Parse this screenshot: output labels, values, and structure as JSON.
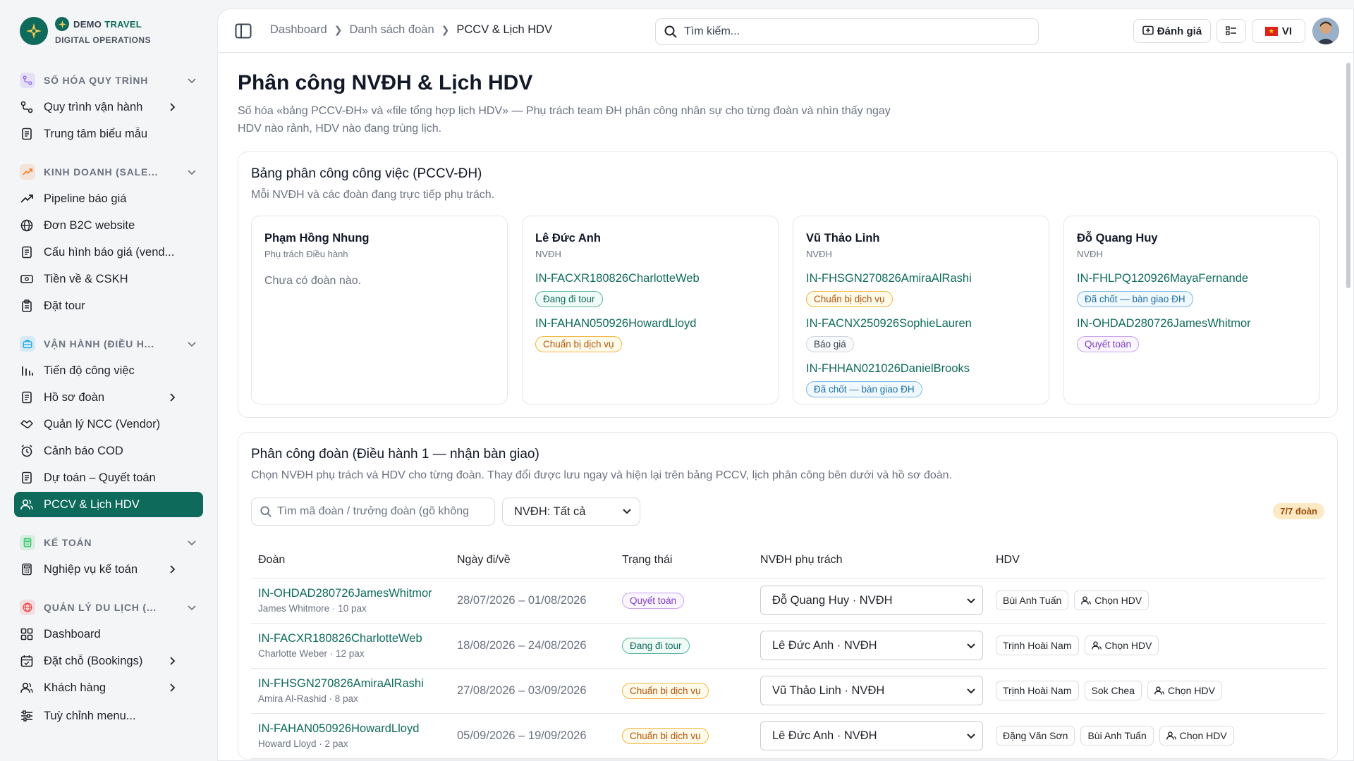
{
  "brand": {
    "name_bold": "DEMO",
    "name_accent": "TRAVEL",
    "subtitle": "DIGITAL OPERATIONS"
  },
  "sidebar": {
    "groups": [
      {
        "label": "SỐ HÓA QUY TRÌNH",
        "icon": "workflow-icon",
        "color": "#8b5cf6",
        "items": [
          {
            "label": "Quy trình vận hành",
            "icon": "workflow-icon",
            "has_children": true
          },
          {
            "label": "Trung tâm biểu mẫu",
            "icon": "document-icon",
            "has_children": false
          }
        ]
      },
      {
        "label": "KINH DOANH (SALE...",
        "icon": "trend-up-icon",
        "color": "#f97316",
        "items": [
          {
            "label": "Pipeline báo giá",
            "icon": "trend-up-icon",
            "has_children": false
          },
          {
            "label": "Đơn B2C website",
            "icon": "globe-icon",
            "has_children": false
          },
          {
            "label": "Cấu hình báo giá (vend...",
            "icon": "document-icon",
            "has_children": false
          },
          {
            "label": "Tiền về & CSKH",
            "icon": "money-icon",
            "has_children": false
          },
          {
            "label": "Đặt tour",
            "icon": "clipboard-icon",
            "has_children": false
          }
        ]
      },
      {
        "label": "VẬN HÀNH (ĐIỀU H...",
        "icon": "briefcase-icon",
        "color": "#0ea5e9",
        "items": [
          {
            "label": "Tiến độ công việc",
            "icon": "progress-icon",
            "has_children": false
          },
          {
            "label": "Hồ sơ đoàn",
            "icon": "document-icon",
            "has_children": true
          },
          {
            "label": "Quản lý NCC (Vendor)",
            "icon": "handshake-icon",
            "has_children": false
          },
          {
            "label": "Cảnh báo COD",
            "icon": "alarm-icon",
            "has_children": false
          },
          {
            "label": "Dự toán – Quyết toán",
            "icon": "document-icon",
            "has_children": false
          },
          {
            "label": "PCCV & Lịch HDV",
            "icon": "users-icon",
            "has_children": false,
            "active": true
          }
        ]
      },
      {
        "label": "KẾ TOÁN",
        "icon": "calculator-icon",
        "color": "#22c55e",
        "items": [
          {
            "label": "Nghiệp vụ kế toán",
            "icon": "calculator-icon",
            "has_children": true
          }
        ]
      },
      {
        "label": "QUẢN LÝ DU LỊCH (...",
        "icon": "globe-icon",
        "color": "#ef4444",
        "items": [
          {
            "label": "Dashboard",
            "icon": "grid-icon",
            "has_children": false
          },
          {
            "label": "Đặt chỗ (Bookings)",
            "icon": "calendar-icon",
            "has_children": true
          },
          {
            "label": "Khách hàng",
            "icon": "users-icon",
            "has_children": true
          }
        ]
      }
    ],
    "customize": "Tuỳ chỉnh menu..."
  },
  "topbar": {
    "breadcrumb": [
      "Dashboard",
      "Danh sách đoàn",
      "PCCV & Lịch HDV"
    ],
    "search_placeholder": "Tìm kiếm...",
    "review_label": "Đánh giá",
    "lang_label": "VI"
  },
  "page": {
    "title": "Phân công NVĐH & Lịch HDV",
    "description": "Số hóa «bảng PCCV-ĐH» và «file tổng hợp lịch HDV» — Phụ trách team ĐH phân công nhân sự cho từng đoàn và nhìn thấy ngay HDV nào rảnh, HDV nào đang trùng lịch."
  },
  "pccv": {
    "title": "Bảng phân công công việc (PCCV-ĐH)",
    "subtitle": "Mỗi NVĐH và các đoàn đang trực tiếp phụ trách.",
    "staff": [
      {
        "name": "Phạm Hồng Nhung",
        "role": "Phụ trách Điều hành",
        "empty": "Chưa có đoàn nào.",
        "assignments": []
      },
      {
        "name": "Lê Đức Anh",
        "role": "NVĐH",
        "assignments": [
          {
            "code": "IN-FACXR180826CharlotteWeb",
            "status": "Đang đi tour",
            "kind": "tour"
          },
          {
            "code": "IN-FAHAN050926HowardLloyd",
            "status": "Chuẩn bị dịch vụ",
            "kind": "prep"
          }
        ]
      },
      {
        "name": "Vũ Thảo Linh",
        "role": "NVĐH",
        "assignments": [
          {
            "code": "IN-FHSGN270826AmiraAlRashi",
            "status": "Chuẩn bị dịch vụ",
            "kind": "prep"
          },
          {
            "code": "IN-FACNX250926SophieLauren",
            "status": "Báo giá",
            "kind": "quote"
          },
          {
            "code": "IN-FHHAN021026DanielBrooks",
            "status": "Đã chốt — bàn giao ĐH",
            "kind": "closed"
          }
        ]
      },
      {
        "name": "Đỗ Quang Huy",
        "role": "NVĐH",
        "assignments": [
          {
            "code": "IN-FHLPQ120926MayaFernande",
            "status": "Đã chốt — bàn giao ĐH",
            "kind": "closed"
          },
          {
            "code": "IN-OHDAD280726JamesWhitmor",
            "status": "Quyết toán",
            "kind": "settle"
          }
        ]
      }
    ]
  },
  "assign": {
    "title": "Phân công đoàn (Điều hành 1 — nhận bàn giao)",
    "subtitle": "Chọn NVĐH phụ trách và HDV cho từng đoàn. Thay đổi được lưu ngay và hiện lại trên bảng PCCV, lịch phân công bên dưới và hồ sơ đoàn.",
    "search_placeholder": "Tìm mã đoàn / trưởng đoàn (gõ không",
    "filter_value": "NVĐH: Tất cả",
    "count": "7/7 đoàn",
    "columns": [
      "Đoàn",
      "Ngày đi/về",
      "Trạng thái",
      "NVĐH phụ trách",
      "HDV"
    ],
    "choose_hdv": "Chọn HDV",
    "rows": [
      {
        "code": "IN-OHDAD280726JamesWhitmor",
        "lead": "James Whitmore · 10 pax",
        "dates": "28/07/2026 – 01/08/2026",
        "status": "Quyết toán",
        "kind": "settle",
        "nvdh": "Đỗ Quang Huy · NVĐH",
        "hdv": [
          "Bùi Anh Tuấn"
        ]
      },
      {
        "code": "IN-FACXR180826CharlotteWeb",
        "lead": "Charlotte Weber · 12 pax",
        "dates": "18/08/2026 – 24/08/2026",
        "status": "Đang đi tour",
        "kind": "tour",
        "nvdh": "Lê Đức Anh · NVĐH",
        "hdv": [
          "Trịnh Hoài Nam"
        ]
      },
      {
        "code": "IN-FHSGN270826AmiraAlRashi",
        "lead": "Amira Al-Rashid · 8 pax",
        "dates": "27/08/2026 – 03/09/2026",
        "status": "Chuẩn bị dịch vụ",
        "kind": "prep",
        "nvdh": "Vũ Thảo Linh · NVĐH",
        "hdv": [
          "Trịnh Hoài Nam",
          "Sok Chea"
        ]
      },
      {
        "code": "IN-FAHAN050926HowardLloyd",
        "lead": "Howard Lloyd · 2 pax",
        "dates": "05/09/2026 – 19/09/2026",
        "status": "Chuẩn bị dịch vụ",
        "kind": "prep",
        "nvdh": "Lê Đức Anh · NVĐH",
        "hdv": [
          "Đặng Văn Sơn",
          "Bùi Anh Tuấn"
        ]
      }
    ]
  },
  "colors": {
    "primary": "#0e6b5c"
  }
}
